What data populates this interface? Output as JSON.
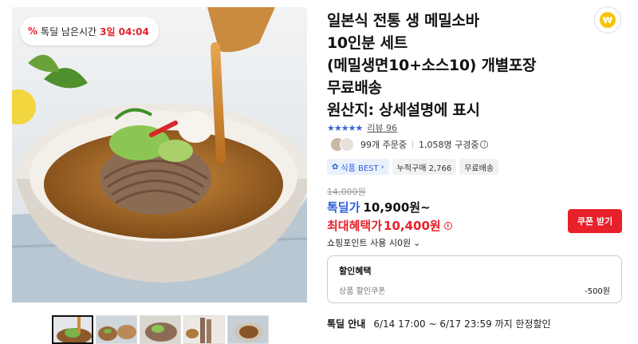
{
  "badge": {
    "icon": "%",
    "label": "톡딜 남은시간",
    "time": "3일 04:04"
  },
  "product": {
    "title_lines": [
      "일본식 전통 생 메밀소바",
      "10인분 세트",
      "(메밀생면10+소스10) 개별포장",
      "무료배송",
      "원산지: 상세설명에 표시"
    ],
    "stars": "★★★★★",
    "review_label": "리뷰 96",
    "order_count": "99개 주문중",
    "buyer_count": "1,058명 구경중"
  },
  "tags": [
    {
      "label": "식품 BEST",
      "suffix": "›"
    },
    {
      "label": "누적구매 2,766"
    },
    {
      "label": "무료배송"
    }
  ],
  "price": {
    "original": "14,000원",
    "deal_label": "톡딜가",
    "deal_value": "10,900원~",
    "max_label": "최대혜택가",
    "max_value": "10,400원"
  },
  "coupon_button": "쿠폰 받기",
  "shopping_point": "쇼핑포인트 사용 시0원",
  "discount": {
    "header": "할인혜택",
    "row_label": "상품 할인쿠폰",
    "row_value": "-500원"
  },
  "deal_info": {
    "label": "톡딜 안내",
    "value": "6/14 17:00 ~ 6/17 23:59 까지 한정할인"
  },
  "icons": {
    "coin": "coin-icon",
    "info": "info-icon",
    "chevron": "chevron-down-icon",
    "star": "star-icon"
  },
  "colors": {
    "accent_red": "#e8202a",
    "accent_blue": "#2e5fd9",
    "coin_yellow": "#f7c600"
  }
}
